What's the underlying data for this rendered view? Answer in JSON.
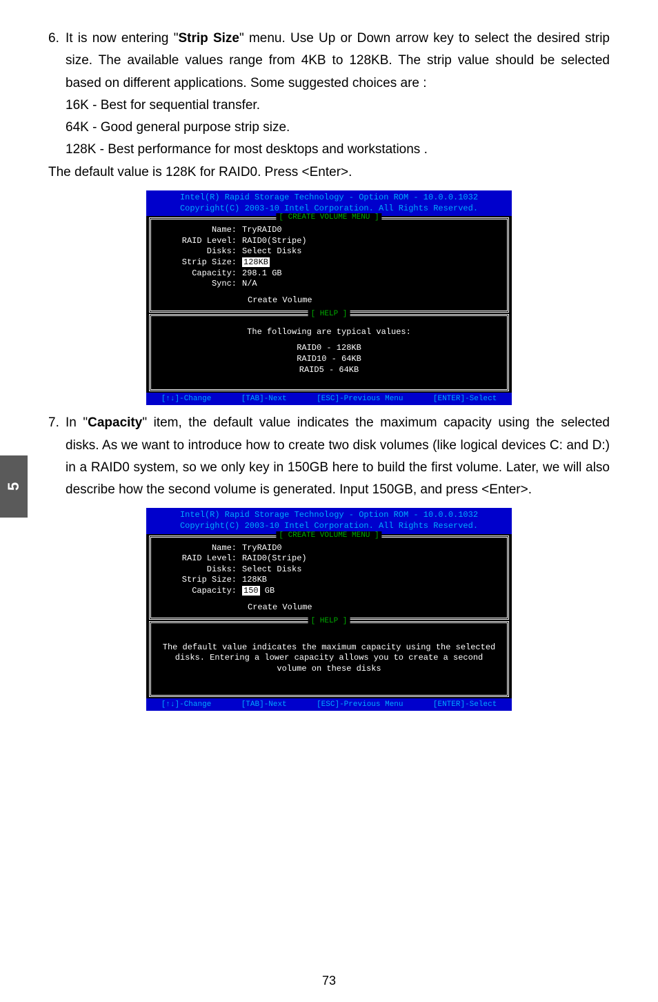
{
  "sideTab": "5",
  "pageNumber": "73",
  "step6": {
    "num": "6.",
    "text1": "It is now entering \"",
    "bold1": "Strip Size",
    "text2": "\" menu. Use Up or Down arrow key to select the desired strip size. The available values range from 4KB to 128KB. The strip value should be selected based on different applications. Some suggested choices are :",
    "line1": "16K - Best for sequential transfer.",
    "line2": "64K - Good general purpose strip size.",
    "line3": "128K - Best performance for most desktops and workstations .",
    "line4": "The default value is 128K for RAID0. Press <Enter>."
  },
  "step7": {
    "num": "7.",
    "text1": "In \"",
    "bold1": "Capacity",
    "text2": "\" item, the default value indicates the maximum capacity using the selected disks. As we want to introduce how to create two disk volumes (like logical devices C: and D:) in a RAID0 system, so we only key in 150GB here to build the first volume. Later, we will also describe how the second volume is generated. Input 150GB, and press <Enter>."
  },
  "bios": {
    "headerLine1": "Intel(R) Rapid Storage Technology - Option ROM - 10.0.0.1032",
    "headerLine2": "Copyright(C) 2003-10 Intel Corporation.   All Rights Reserved.",
    "menuTitle": "CREATE VOLUME MENU",
    "helpTitle": "HELP",
    "fields": {
      "nameLabel": "Name:",
      "nameValue": "TryRAID0",
      "raidLevelLabel": "RAID Level:",
      "raidLevelValue": "RAID0(Stripe)",
      "disksLabel": "Disks:",
      "disksValue": "Select Disks",
      "stripSizeLabel": "Strip Size:",
      "stripSizeValue1": "128KB",
      "stripSizeValue2": "128KB",
      "capacityLabel": "Capacity:",
      "capacityValue1": "298.1   GB",
      "capacityValue2a": "150",
      "capacityValue2b": "    GB",
      "syncLabel": "Sync:",
      "syncValue": "N/A",
      "createVolume": "Create Volume"
    },
    "help1": {
      "line1": "The following are typical values:",
      "line2": "RAID0   -  128KB",
      "line3": "RAID10 -  64KB",
      "line4": "RAID5   -  64KB"
    },
    "help2": {
      "line1": "The default value indicates the maximum capacity using the selected",
      "line2": "disks. Entering a lower capacity allows you to create a second",
      "line3": "volume on these disks"
    },
    "footer": {
      "change": "[↑↓]-Change",
      "next": "[TAB]-Next",
      "prev": "[ESC]-Previous Menu",
      "select": "[ENTER]-Select"
    }
  }
}
